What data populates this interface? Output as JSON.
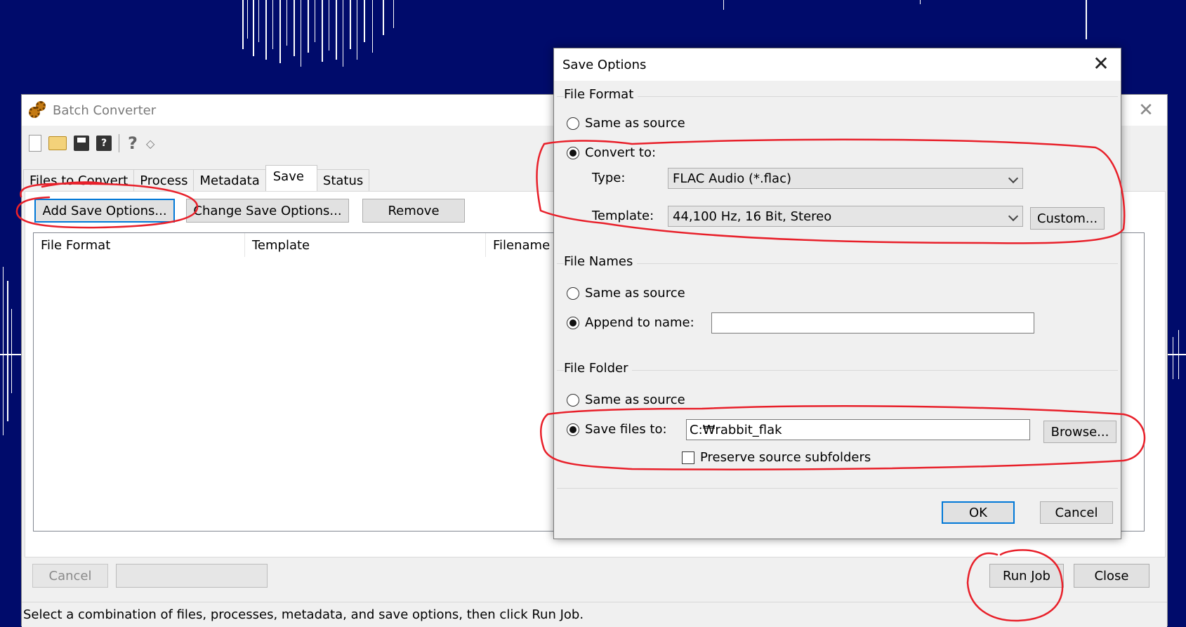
{
  "main_window": {
    "title": "Batch Converter",
    "tabs": [
      {
        "label": "Files to Convert"
      },
      {
        "label": "Process"
      },
      {
        "label": "Metadata"
      },
      {
        "label": "Save"
      },
      {
        "label": "Status"
      }
    ],
    "active_tab": "Save",
    "buttons": {
      "add_save_options": "Add Save Options...",
      "change_save_options": "Change Save Options...",
      "remove": "Remove",
      "cancel": "Cancel",
      "run_job": "Run Job",
      "close": "Close"
    },
    "list_columns": [
      "File Format",
      "Template",
      "Filename"
    ],
    "status_text": "Select a combination of files, processes, metadata, and save options, then click Run Job."
  },
  "save_options": {
    "title": "Save Options",
    "file_format": {
      "label": "File Format",
      "same_as_source": "Same as source",
      "convert_to": "Convert to:",
      "type_label": "Type:",
      "type_value": "FLAC Audio (*.flac)",
      "template_label": "Template:",
      "template_value": "44,100 Hz, 16 Bit, Stereo",
      "custom_button": "Custom..."
    },
    "file_names": {
      "label": "File Names",
      "same_as_source": "Same as source",
      "append_to_name": "Append to name:",
      "append_value": ""
    },
    "file_folder": {
      "label": "File Folder",
      "same_as_source": "Same as source",
      "save_files_to": "Save files to:",
      "path_value": "C:₩rabbit_flak",
      "browse_button": "Browse...",
      "preserve_subfolders": "Preserve source subfolders"
    },
    "ok_button": "OK",
    "cancel_button": "Cancel"
  },
  "colors": {
    "background": "#000b6b",
    "annotation": "#e8202a",
    "focus": "#0078d7"
  }
}
